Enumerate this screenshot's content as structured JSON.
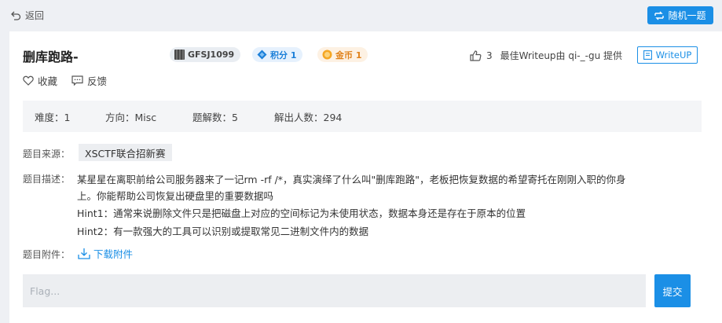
{
  "topbar": {
    "back_label": "返回",
    "random_label": "随机一题"
  },
  "challenge": {
    "title": "删库跑路-",
    "id_badge": "GFSJ1099",
    "score_badge": "积分 1",
    "gold_badge": "金币 1",
    "likes_count": "3",
    "best_writeup_text": "最佳Writeup由 qi-_-gu 提供",
    "writeup_button": "WriteUP",
    "favorite_label": "收藏",
    "feedback_label": "反馈"
  },
  "stats": {
    "difficulty": "难度：1",
    "direction": "方向：Misc",
    "solutions": "题解数：5",
    "solvers": "解出人数：294"
  },
  "details": {
    "source_label": "题目来源：",
    "source_value": "XSCTF联合招新赛",
    "description_label": "题目描述：",
    "description_lines": [
      "某星星在离职前给公司服务器来了一记rm -rf /*，真实演绎了什么叫\"删库跑路\"，老板把恢复数据的希望寄托在刚刚入职的你身",
      "上。你能帮助公司恢复出硬盘里的重要数据吗",
      "Hint1：通常来说删除文件只是把磁盘上对应的空间标记为未使用状态，数据本身还是存在于原本的位置",
      "Hint2：有一款强大的工具可以识别或提取常见二进制文件内的数据"
    ],
    "attachment_label": "题目附件：",
    "download_label": "下载附件"
  },
  "flag": {
    "placeholder": "Flag...",
    "value": "",
    "submit_label": "提交"
  },
  "colors": {
    "accent": "#1b8fe6",
    "page_bg": "#eef0f4",
    "gold": "#e0821b"
  },
  "icons": {
    "back": "back-arrow-icon",
    "random": "shuffle-icon",
    "id": "qr-icon",
    "score": "diamond-icon",
    "gold": "coin-icon",
    "like": "thumbs-up-icon",
    "writeup": "document-icon",
    "favorite": "heart-icon",
    "feedback": "message-icon",
    "download": "download-icon"
  }
}
